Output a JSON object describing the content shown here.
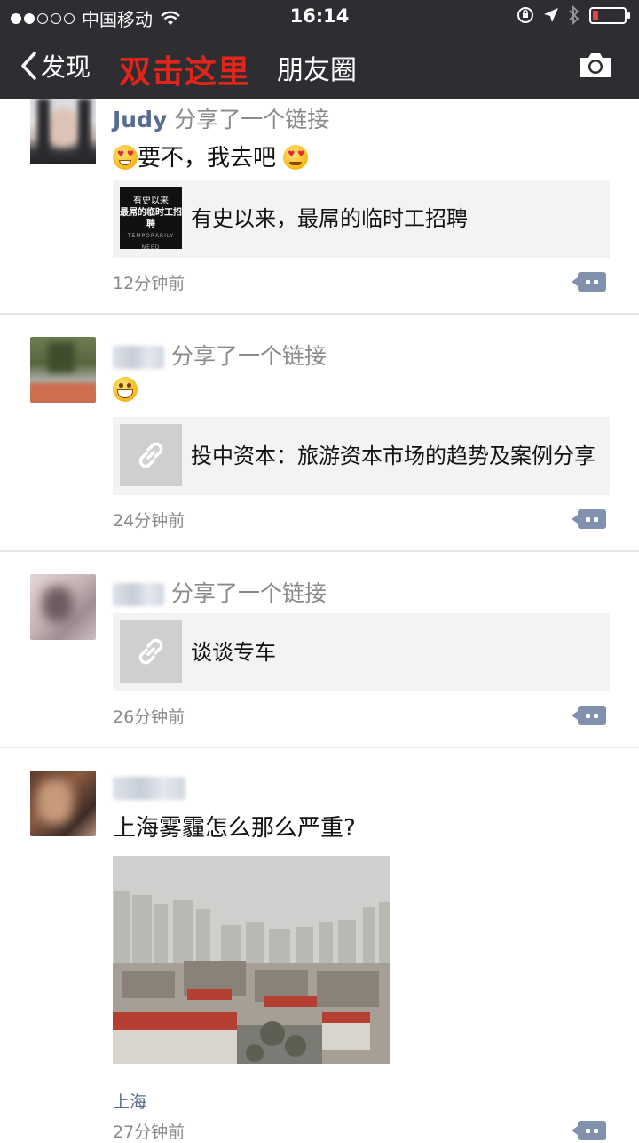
{
  "status_bar": {
    "carrier": "中国移动",
    "time": "16:14"
  },
  "nav": {
    "back_label": "发现",
    "annotation": "双击这里",
    "title": "朋友圈"
  },
  "posts": [
    {
      "name": "Judy",
      "action": "分享了一个链接",
      "text": "要不，我去吧",
      "link": {
        "title": "有史以来，最屌的临时工招聘",
        "thumb_lines": [
          "有史以来",
          "最屌的临时工招聘",
          "TEMPORARILY NEED"
        ]
      },
      "time": "12分钟前"
    },
    {
      "action": "分享了一个链接",
      "link": {
        "title": "投中资本：旅游资本市场的趋势及案例分享"
      },
      "time": "24分钟前"
    },
    {
      "action": "分享了一个链接",
      "link": {
        "title": "谈谈专车"
      },
      "time": "26分钟前"
    },
    {
      "text": "上海雾霾怎么那么严重?",
      "location": "上海",
      "time": "27分钟前"
    }
  ],
  "colors": {
    "topbar": "#2e2e32",
    "annotation": "#e1251b",
    "nickname": "#576b95",
    "comment_button": "#8190ad"
  },
  "icons": [
    "back-chevron-icon",
    "camera-icon",
    "link-icon",
    "comment-icon",
    "wifi-icon",
    "battery-icon"
  ]
}
